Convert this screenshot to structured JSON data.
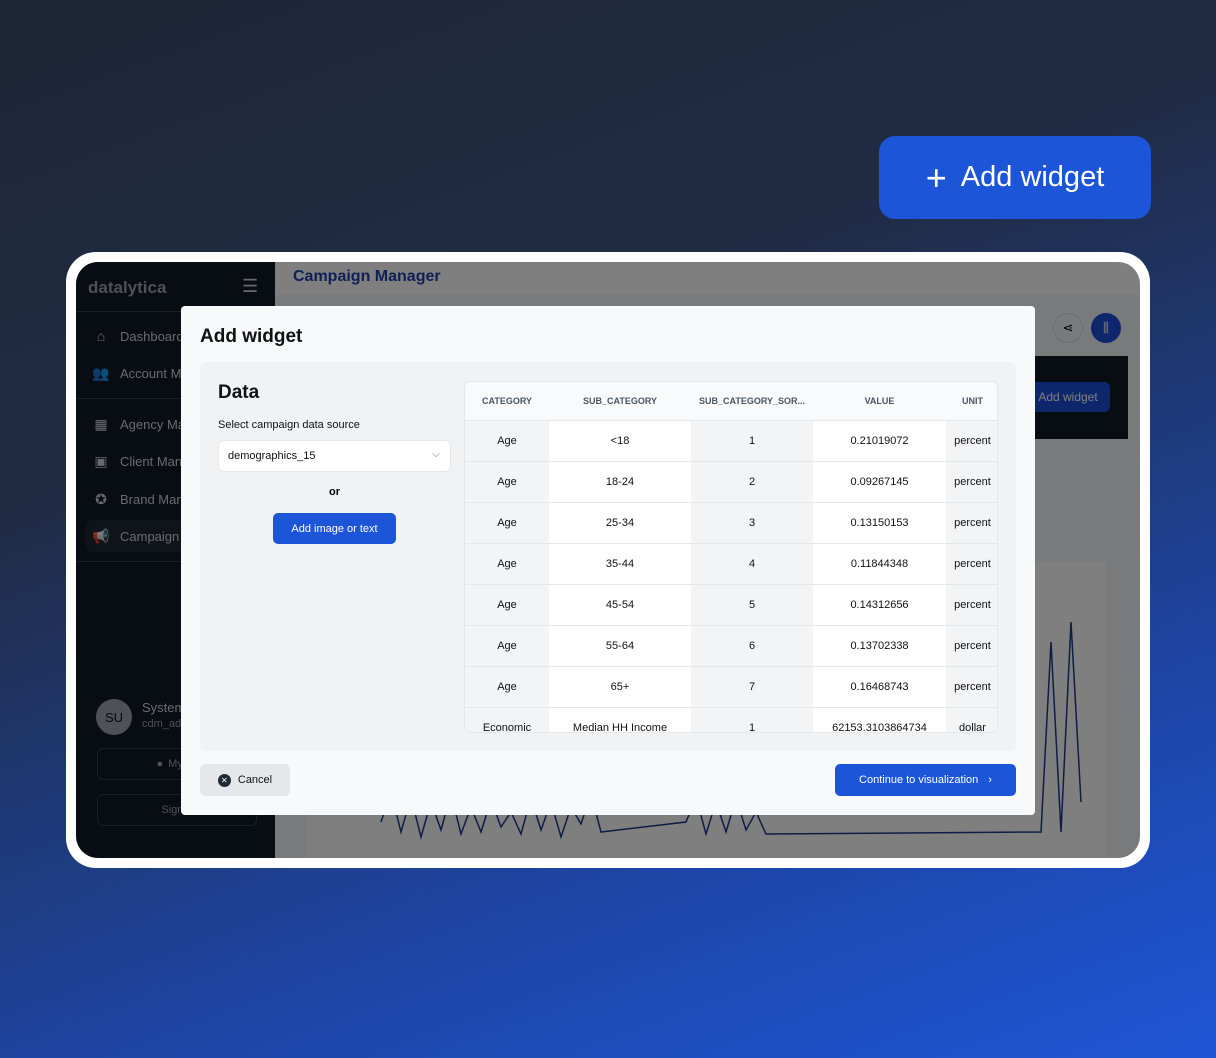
{
  "hero_button": {
    "label": "Add widget",
    "icon": "plus-icon"
  },
  "sidebar": {
    "logo": "datalytica",
    "items": [
      {
        "label": "Dashboard",
        "icon": "home-icon"
      },
      {
        "label": "Account M",
        "icon": "users-icon"
      },
      {
        "label": "Agency Ma",
        "icon": "presentation-icon"
      },
      {
        "label": "Client Man",
        "icon": "briefcase-icon"
      },
      {
        "label": "Brand Man",
        "icon": "award-icon"
      },
      {
        "label": "Campaign",
        "icon": "megaphone-icon"
      }
    ],
    "user": {
      "initials": "SU",
      "name": "System",
      "email": "cdm_ad"
    },
    "my_account": "My ac",
    "sign_out": "Sign o"
  },
  "main": {
    "title": "Campaign Manager",
    "add_widget": "Add widget"
  },
  "modal": {
    "title": "Add widget",
    "section_title": "Data",
    "source_label": "Select campaign data source",
    "source_value": "demographics_15",
    "or": "or",
    "add_image_label": "Add image or text",
    "cancel_label": "Cancel",
    "continue_label": "Continue to visualization",
    "table": {
      "columns": [
        "CATEGORY",
        "SUB_CATEGORY",
        "SUB_CATEGORY_SOR...",
        "VALUE",
        "UNIT"
      ],
      "rows": [
        [
          "Age",
          "<18",
          "1",
          "0.21019072",
          "percent"
        ],
        [
          "Age",
          "18-24",
          "2",
          "0.09267145",
          "percent"
        ],
        [
          "Age",
          "25-34",
          "3",
          "0.13150153",
          "percent"
        ],
        [
          "Age",
          "35-44",
          "4",
          "0.11844348",
          "percent"
        ],
        [
          "Age",
          "45-54",
          "5",
          "0.14312656",
          "percent"
        ],
        [
          "Age",
          "55-64",
          "6",
          "0.13702338",
          "percent"
        ],
        [
          "Age",
          "65+",
          "7",
          "0.16468743",
          "percent"
        ],
        [
          "Economic",
          "Median HH Income",
          "1",
          "62153.3103864734",
          "dollar"
        ]
      ]
    }
  }
}
